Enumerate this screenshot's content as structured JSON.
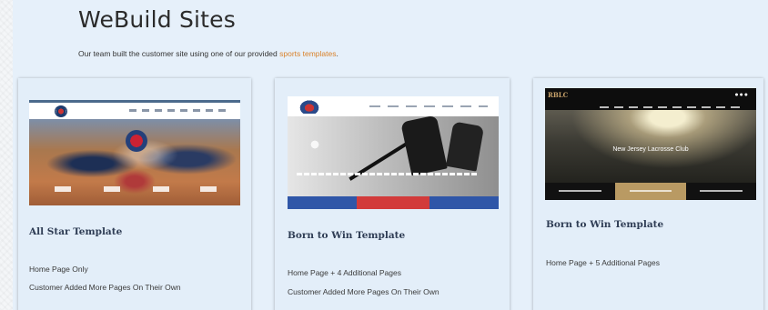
{
  "header": {
    "title": "WeBuild Sites",
    "intro_prefix": "Our team built the customer site using one of our provided ",
    "intro_link": "sports templates",
    "intro_suffix": "."
  },
  "colors": {
    "panel_bg": "#e6f0fa",
    "link": "#d9822b",
    "card_title": "#2f3d55"
  },
  "cards": [
    {
      "title": "All Star Template",
      "lines": [
        "Home Page Only",
        "Customer Added More Pages On Their Own"
      ]
    },
    {
      "title": "Born to Win Template",
      "lines": [
        "Home Page + 4 Additional Pages",
        "Customer Added More Pages On Their Own"
      ]
    },
    {
      "title": "Born to Win Template",
      "lines": [
        "Home Page + 5 Additional Pages"
      ],
      "thumb_logo": "RBLC",
      "thumb_hero_text": "New Jersey Lacrosse Club"
    }
  ]
}
